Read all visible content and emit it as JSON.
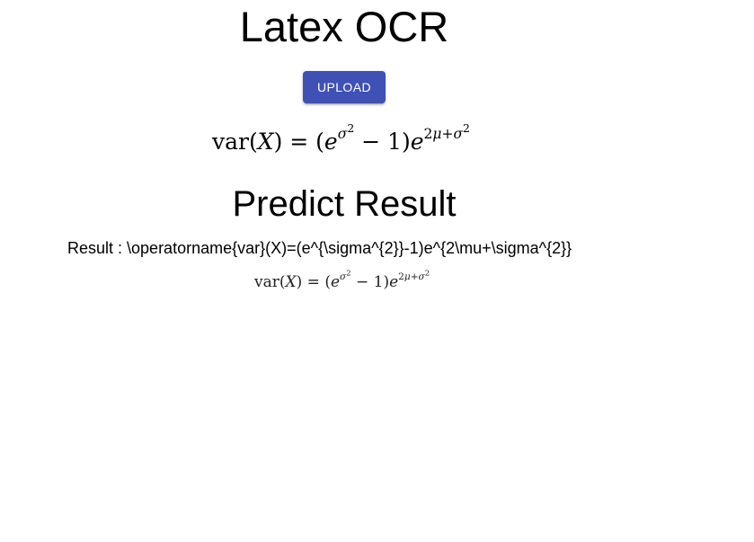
{
  "app": {
    "title": "Latex OCR"
  },
  "upload": {
    "button_label": "UPLOAD"
  },
  "uploaded_formula": {
    "op": "var",
    "arg": "X",
    "eq": "= (",
    "base1": "e",
    "exp1_var": "σ",
    "exp1_pow": "2",
    "minus_one": " − 1)",
    "base2": "e",
    "exp2_a": "2",
    "exp2_mu": "μ",
    "exp2_plus": "+",
    "exp2_sigma": "σ",
    "exp2_pow": "2"
  },
  "prediction": {
    "heading": "Predict Result",
    "result_prefix": "Result : ",
    "result_latex": "\\operatorname{var}(X)=(e^{\\sigma^{2}}-1)e^{2\\mu+\\sigma^{2}}"
  }
}
